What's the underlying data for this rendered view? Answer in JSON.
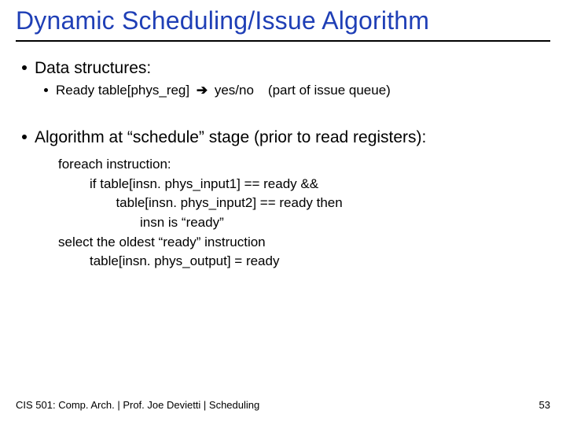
{
  "title": "Dynamic Scheduling/Issue Algorithm",
  "b1": "Data structures:",
  "b1a_pre": "Ready table[phys_reg] ",
  "arrow": "➔",
  "b1a_mid": " yes/no",
  "b1a_note": "(part of issue queue)",
  "b2": "Algorithm at “schedule” stage (prior to read registers):",
  "code": {
    "l1": "foreach instruction:",
    "l2": "if table[insn. phys_input1] == ready &&",
    "l3": "  table[insn. phys_input2] == ready then",
    "l4": "insn is “ready”",
    "l5": "select the oldest “ready” instruction",
    "l6": "table[insn. phys_output] = ready"
  },
  "footer_left": "CIS 501: Comp. Arch.  |  Prof. Joe Devietti  |  Scheduling",
  "footer_right": "53"
}
